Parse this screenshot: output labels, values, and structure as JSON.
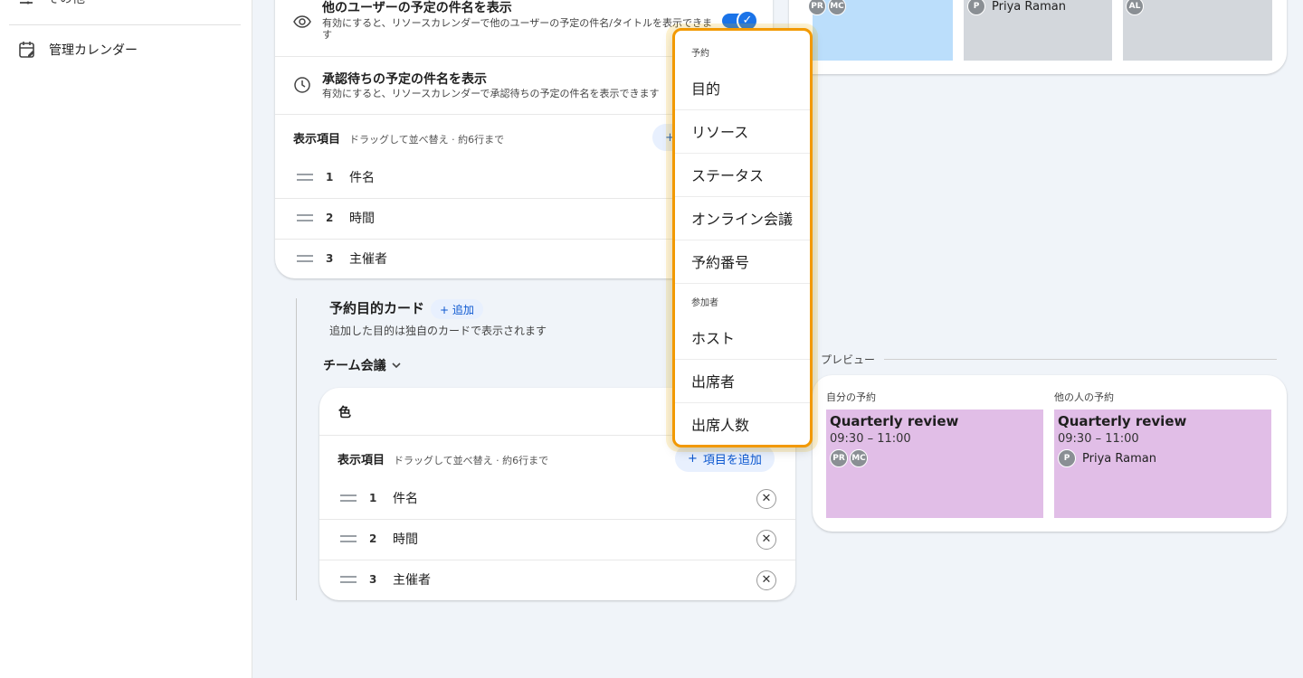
{
  "sidebar": {
    "top_item_label": "その他",
    "item_admin_calendar": "管理カレンダー"
  },
  "settings": {
    "show_others_title": {
      "title": "他のユーザーの予定の件名を表示",
      "desc": "有効にすると、リソースカレンダーで他のユーザーの予定の件名/タイトルを表示できます",
      "enabled": true
    },
    "show_pending_title": {
      "title": "承認待ちの予定の件名を表示",
      "desc": "有効にすると、リソースカレンダーで承認待ちの予定の件名を表示できます"
    },
    "display_items": {
      "title": "表示項目",
      "hint": "ドラッグして並べ替え · 約6行まで",
      "rows": [
        {
          "num": "1",
          "label": "件名"
        },
        {
          "num": "2",
          "label": "時間"
        },
        {
          "num": "3",
          "label": "主催者"
        }
      ]
    }
  },
  "purpose": {
    "title": "予約目的カード",
    "add_label": "+ 追加",
    "desc": "追加した目的は独自のカードで表示されます",
    "selected_purpose": "チーム会議",
    "card": {
      "color_label": "色",
      "display_title": "表示項目",
      "display_hint": "ドラッグして並べ替え · 約6行まで",
      "add_item_label": "項目を追加",
      "rows": [
        {
          "num": "1",
          "label": "件名"
        },
        {
          "num": "2",
          "label": "時間"
        },
        {
          "num": "3",
          "label": "主催者"
        }
      ]
    }
  },
  "preview_top": {
    "blocks": [
      {
        "color": "#bbdefb",
        "avatars": [
          "PR",
          "MC"
        ]
      },
      {
        "color": "#d3d7dc",
        "avatars": [
          "P"
        ],
        "name": "Priya Raman"
      },
      {
        "color": "#d3d7dc",
        "avatars": [
          "AL"
        ]
      }
    ]
  },
  "preview": {
    "label": "プレビュー",
    "mine_label": "自分の予約",
    "others_label": "他の人の予約",
    "event_title": "Quarterly review",
    "event_time": "09:30 – 11:00",
    "mine_avatars": [
      "PR",
      "MC"
    ],
    "others_avatar": "P",
    "others_name": "Priya Raman",
    "event_color": "#e1bee7"
  },
  "menu": {
    "section_booking": "予約",
    "booking_items": [
      "目的",
      "リソース",
      "ステータス",
      "オンライン会議",
      "予約番号"
    ],
    "section_participants": "参加者",
    "participant_items": [
      "ホスト",
      "出席者",
      "出席人数"
    ]
  }
}
